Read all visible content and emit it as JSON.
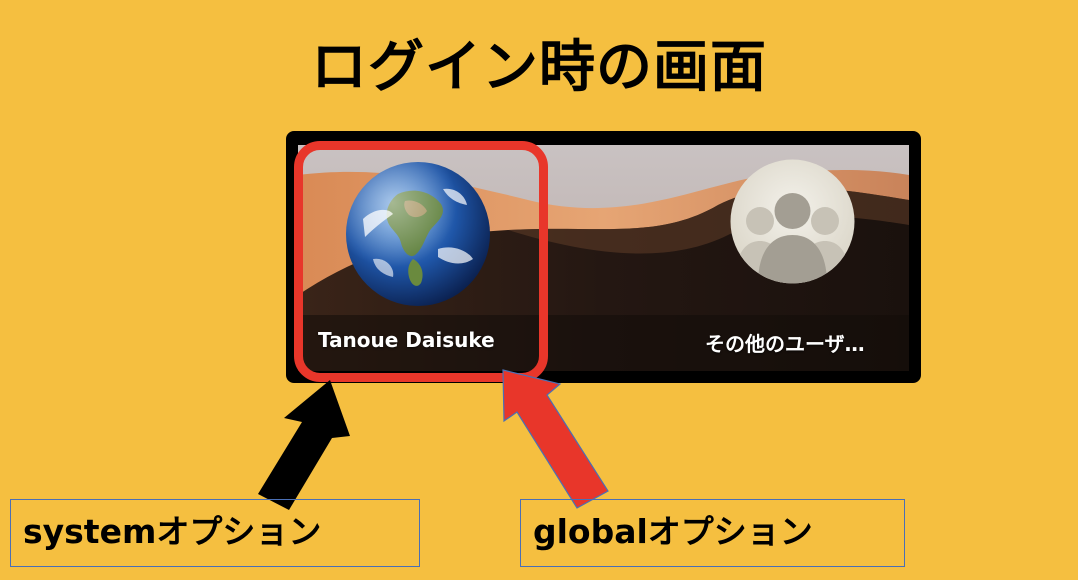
{
  "page": {
    "title": "ログイン時の画面"
  },
  "login_screen": {
    "users": [
      {
        "name": "Tanoue Daisuke",
        "avatar": "earth-globe-icon"
      },
      {
        "name": "その他のユーザ…",
        "avatar": "generic-user-silhouette-icon"
      }
    ]
  },
  "annotations": {
    "system_option": "systemオプション",
    "global_option": "globalオプション"
  },
  "colors": {
    "background": "#f5bf40",
    "highlight": "#e8362a",
    "black_arrow": "#000000",
    "red_arrow": "#e8362a",
    "label_border": "#4a6fb5"
  }
}
